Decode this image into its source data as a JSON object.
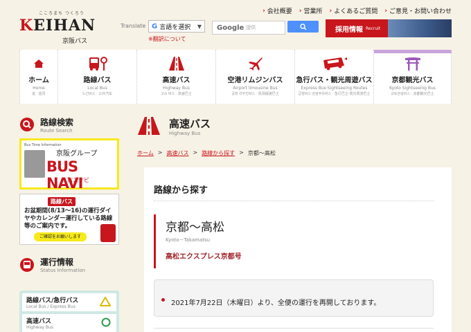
{
  "header": {
    "logo_small": "こころまち つくろう",
    "logo_main_k": "K",
    "logo_main_rest": "EIHAN",
    "logo_tag": "京阪バス",
    "translate_label": "Translate",
    "translate_select": "言語を選択",
    "translate_about": "※翻訳について",
    "search_brand": "Google",
    "search_hint": "提供",
    "recruit_label": "採用情報",
    "recruit_en": "Recruit",
    "top_links": [
      "会社概要",
      "営業所",
      "よくあるご質問",
      "ご意見・お問い合わせ"
    ]
  },
  "nav": [
    {
      "label": "ホーム",
      "en": "Home",
      "ko": "홈 · 首頁",
      "icon": "home-icon"
    },
    {
      "label": "路線バス",
      "en": "Local Bus",
      "ko": "노선버스 · 公共汽车",
      "icon": "bus-stop-icon"
    },
    {
      "label": "高速バス",
      "en": "Highway Bus",
      "ko": "고속 버스 · 高速巴士",
      "icon": "highway-icon"
    },
    {
      "label": "空港リムジンバス",
      "en": "Airport limousine Bus",
      "ko": "공항 리무진버스 · 机场摆渡巴士",
      "icon": "airplane-icon"
    },
    {
      "label": "急行バス・観光周遊バス",
      "en": "Express Bus·Sightseeing Routes",
      "ko": "급행버스·관광주유버스 · 急行巴士·观光周游巴士",
      "icon": "express-bus-icon"
    },
    {
      "label": "京都観光バス",
      "en": "Kyoto Sightseeing Bus",
      "ko": "교토관광버스 · 京都観光巴士",
      "icon": "torii-icon"
    }
  ],
  "sidebar": {
    "route_search": "路線検索",
    "route_search_en": "Route Search",
    "busnavi_small": "Bus Time Information",
    "busnavi_group": "京阪グループ",
    "busnavi_big": "BUS NAVI",
    "busnavi_kana": "バスナビ",
    "notice_badge": "路線バス",
    "notice_body": "お盆期間(8/13〜16)の運行ダイヤやカレンダー運行している路線等のご案内です。",
    "notice_cta": "ご確認をお願いします",
    "status_title": "運行情報",
    "status_en": "Status Information",
    "status_rows": [
      {
        "label": "路線バス/急行バス",
        "en": "Local Bus / Express Bus",
        "mark": "triangle"
      },
      {
        "label": "高速バス",
        "en": "Highway Bus",
        "mark": "circle"
      }
    ]
  },
  "main": {
    "title": "高速バス",
    "title_en": "Highway Bus",
    "breadcrumbs": [
      {
        "label": "ホーム",
        "link": true
      },
      {
        "label": "高速バス",
        "link": true
      },
      {
        "label": "路線から探す",
        "link": true
      },
      {
        "label": "京都〜高松",
        "link": false
      }
    ],
    "section_title": "路線から探す",
    "route_name": "京都〜高松",
    "route_en": "Kyoto－Takamatsu",
    "route_sub": "高松エクスプレス京都号",
    "notice": "2021年7月22日（木曜日）より、全便の運行を再開しております。"
  },
  "colors": {
    "accent": "#c8161d",
    "background": "#f7f2e6"
  }
}
